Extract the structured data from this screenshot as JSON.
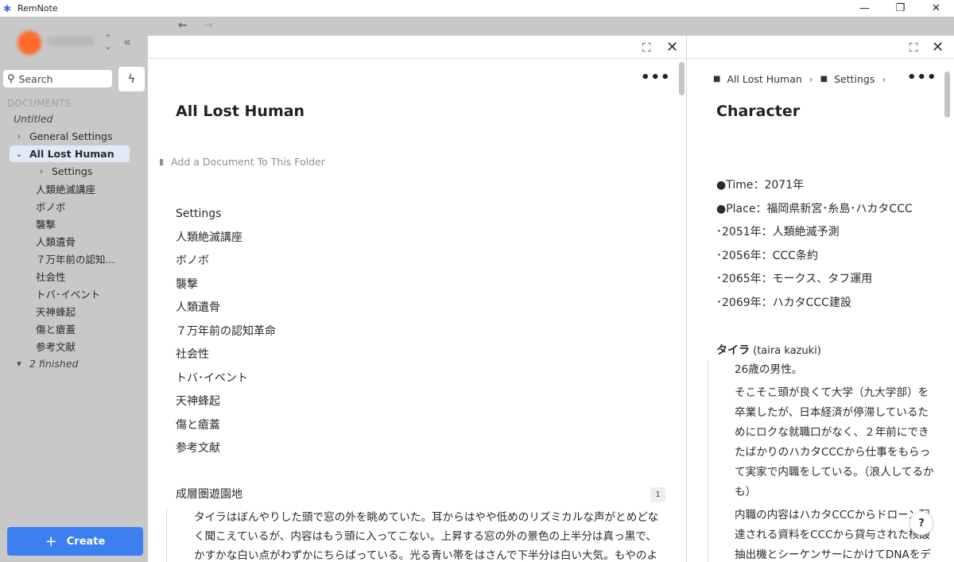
{
  "window": {
    "title": "RemNote"
  },
  "sidebar": {
    "search_placeholder": "Search",
    "documents_label": "DOCUMENTS",
    "items": [
      {
        "label": "Untitled",
        "italic": true,
        "indent": 0,
        "chevron": ""
      },
      {
        "label": "General Settings",
        "indent": 0,
        "chevron": "›"
      },
      {
        "label": "All Lost Human",
        "indent": 0,
        "chevron": "⌄",
        "active": true
      },
      {
        "label": "Settings",
        "indent": 1,
        "chevron": "›"
      },
      {
        "label": "人類絶滅講座",
        "indent": 2,
        "chevron": ""
      },
      {
        "label": "ボノボ",
        "indent": 2,
        "chevron": ""
      },
      {
        "label": "襲撃",
        "indent": 2,
        "chevron": ""
      },
      {
        "label": "人類遺骨",
        "indent": 2,
        "chevron": ""
      },
      {
        "label": "７万年前の認知...",
        "indent": 2,
        "chevron": ""
      },
      {
        "label": "社会性",
        "indent": 2,
        "chevron": ""
      },
      {
        "label": "トバ･イベント",
        "indent": 2,
        "chevron": ""
      },
      {
        "label": "天神蜂起",
        "indent": 2,
        "chevron": ""
      },
      {
        "label": "傷と瘡蓋",
        "indent": 2,
        "chevron": ""
      },
      {
        "label": "参考文献",
        "indent": 2,
        "chevron": ""
      },
      {
        "label": "2 finished",
        "italic": true,
        "indent": 0,
        "chevron": "▾"
      }
    ],
    "create_label": "Create"
  },
  "pane_left": {
    "title": "All Lost Human",
    "add_document": "Add a Document To This Folder",
    "items": [
      "Settings",
      "人類絶滅講座",
      "ボノボ",
      "襲撃",
      "人類遺骨",
      "７万年前の認知革命",
      "社会性",
      "トバ･イベント",
      "天神蜂起",
      "傷と瘡蓋",
      "参考文献"
    ],
    "section_title": "成層圏遊園地",
    "section_badge": "1",
    "paragraph": "タイラはぼんやりした頭で窓の外を眺めていた。耳からはやや低めのリズミカルな声がとめどなく聞こえているが、内容はもう頭に入ってこない。上昇する窓の外の景色の上半分は真っ黒で、かすかな白い点がわずかにちらばっている。光る青い帯をはさんで下半分は白い大気。もやのように重なる雲の波の奥には青"
  },
  "pane_right": {
    "crumb_1": "All Lost Human",
    "crumb_2": "Settings",
    "title": "Character",
    "items": [
      "●Time：2071年",
      "●Place：福岡県新宮･糸島･ハカタCCC",
      "･2051年：人類絶滅予測",
      "･2056年：CCC条約",
      "･2065年：モークス、タフ運用",
      "･2069年：ハカタCCC建設"
    ],
    "taira_name": "タイラ",
    "taira_roman": " (taira kazuki)",
    "para_1": "26歳の男性。",
    "para_2": "そこそこ頭が良くて大学（九大学部）を卒業したが、日本経済が停滞しているためにロクな就職口がなく、２年前にできたばかりのハカタCCCから仕事をもらって実家で内職をしている。（浪人してるかも）",
    "para_3": "内職の内容はハカタCCCからドローン配達される資料をCCCから貸与された核酸抽出機とシーケンサーにかけてDNAをデータ化し、CCCに送ること。"
  },
  "help": "?"
}
